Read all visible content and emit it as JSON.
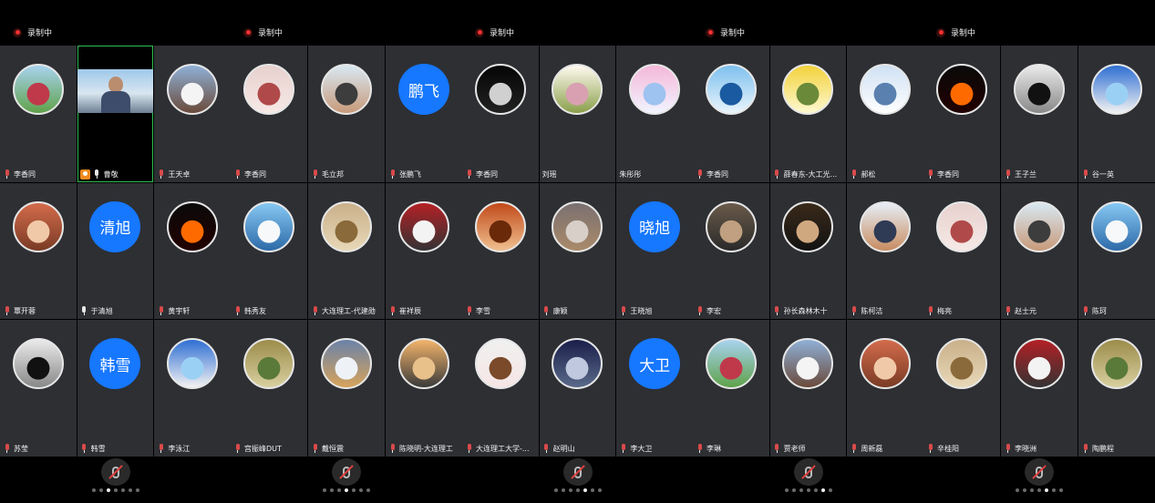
{
  "recording_label": "录制中",
  "colors": {
    "tile_bg": "#2d2f33",
    "text_avatar": "#1677ff",
    "active_border": "#2fbf52",
    "rec": "#f23030"
  },
  "panels": [
    {
      "page_index": 0,
      "tiles": [
        {
          "name": "李香同",
          "avatar": "photo",
          "muted": true
        },
        {
          "name": "曹敬",
          "avatar": "video",
          "muted": false,
          "host": true,
          "active": true
        },
        {
          "name": "王天卓",
          "avatar": "photo",
          "muted": true
        },
        {
          "name": "覃开蓉",
          "avatar": "photo",
          "muted": true
        },
        {
          "name": "于清旭",
          "avatar": "text",
          "avatar_text": "清旭",
          "muted": false
        },
        {
          "name": "黄宇轩",
          "avatar": "photo",
          "muted": true
        },
        {
          "name": "苏莹",
          "avatar": "photo",
          "muted": true
        },
        {
          "name": "韩雪",
          "avatar": "text",
          "avatar_text": "韩雪",
          "muted": true
        },
        {
          "name": "李泳江",
          "avatar": "photo",
          "muted": true
        }
      ]
    },
    {
      "page_index": 1,
      "tiles": [
        {
          "name": "李香同",
          "avatar": "photo",
          "muted": true
        },
        {
          "name": "毛立邦",
          "avatar": "photo",
          "muted": true
        },
        {
          "name": "张鹏飞",
          "avatar": "text",
          "avatar_text": "鹏飞",
          "muted": true
        },
        {
          "name": "韩秀友",
          "avatar": "photo",
          "muted": true
        },
        {
          "name": "大连理工-代建勋",
          "avatar": "photo",
          "muted": true
        },
        {
          "name": "崔祥辰",
          "avatar": "photo",
          "muted": true
        },
        {
          "name": "宫振峰DUT",
          "avatar": "photo",
          "muted": true
        },
        {
          "name": "戴恒震",
          "avatar": "photo",
          "muted": true
        },
        {
          "name": "陈晓明-大连理工",
          "avatar": "photo",
          "muted": true
        }
      ]
    },
    {
      "page_index": 2,
      "tiles": [
        {
          "name": "李香同",
          "avatar": "photo",
          "muted": true
        },
        {
          "name": "刘瑶",
          "avatar": "photo",
          "muted": null
        },
        {
          "name": "朱彤彤",
          "avatar": "photo",
          "muted": null
        },
        {
          "name": "李雪",
          "avatar": "photo",
          "muted": true
        },
        {
          "name": "康颖",
          "avatar": "photo",
          "muted": true
        },
        {
          "name": "王晓旭",
          "avatar": "text",
          "avatar_text": "晓旭",
          "muted": true
        },
        {
          "name": "大连理工大学-...",
          "avatar": "photo",
          "muted": true
        },
        {
          "name": "赵明山",
          "avatar": "photo",
          "muted": true
        },
        {
          "name": "李大卫",
          "avatar": "text",
          "avatar_text": "大卫",
          "muted": true
        }
      ]
    },
    {
      "page_index": 3,
      "tiles": [
        {
          "name": "李香同",
          "avatar": "photo",
          "muted": true
        },
        {
          "name": "薛春东-大工光...",
          "avatar": "photo",
          "muted": true
        },
        {
          "name": "郝松",
          "avatar": "photo",
          "muted": true
        },
        {
          "name": "李宏",
          "avatar": "photo",
          "muted": true
        },
        {
          "name": "孙长森林木十",
          "avatar": "photo",
          "muted": true
        },
        {
          "name": "陈柯洁",
          "avatar": "photo",
          "muted": true
        },
        {
          "name": "李琳",
          "avatar": "photo",
          "muted": true
        },
        {
          "name": "贾老师",
          "avatar": "photo",
          "muted": true
        },
        {
          "name": "周新磊",
          "avatar": "photo",
          "muted": true
        }
      ]
    },
    {
      "page_index": 4,
      "tiles": [
        {
          "name": "李香同",
          "avatar": "photo",
          "muted": true
        },
        {
          "name": "王子兰",
          "avatar": "photo",
          "muted": true
        },
        {
          "name": "谷一英",
          "avatar": "photo",
          "muted": true
        },
        {
          "name": "梅亮",
          "avatar": "photo",
          "muted": true
        },
        {
          "name": "赵士元",
          "avatar": "photo",
          "muted": true
        },
        {
          "name": "陈珂",
          "avatar": "photo",
          "muted": true
        },
        {
          "name": "辛桂阳",
          "avatar": "photo",
          "muted": true
        },
        {
          "name": "李晓洲",
          "avatar": "photo",
          "muted": true
        },
        {
          "name": "陶鹏程",
          "avatar": "photo",
          "muted": true
        }
      ]
    }
  ],
  "pager": {
    "total_pages": 7,
    "current": [
      2,
      3,
      4,
      5,
      4
    ]
  }
}
